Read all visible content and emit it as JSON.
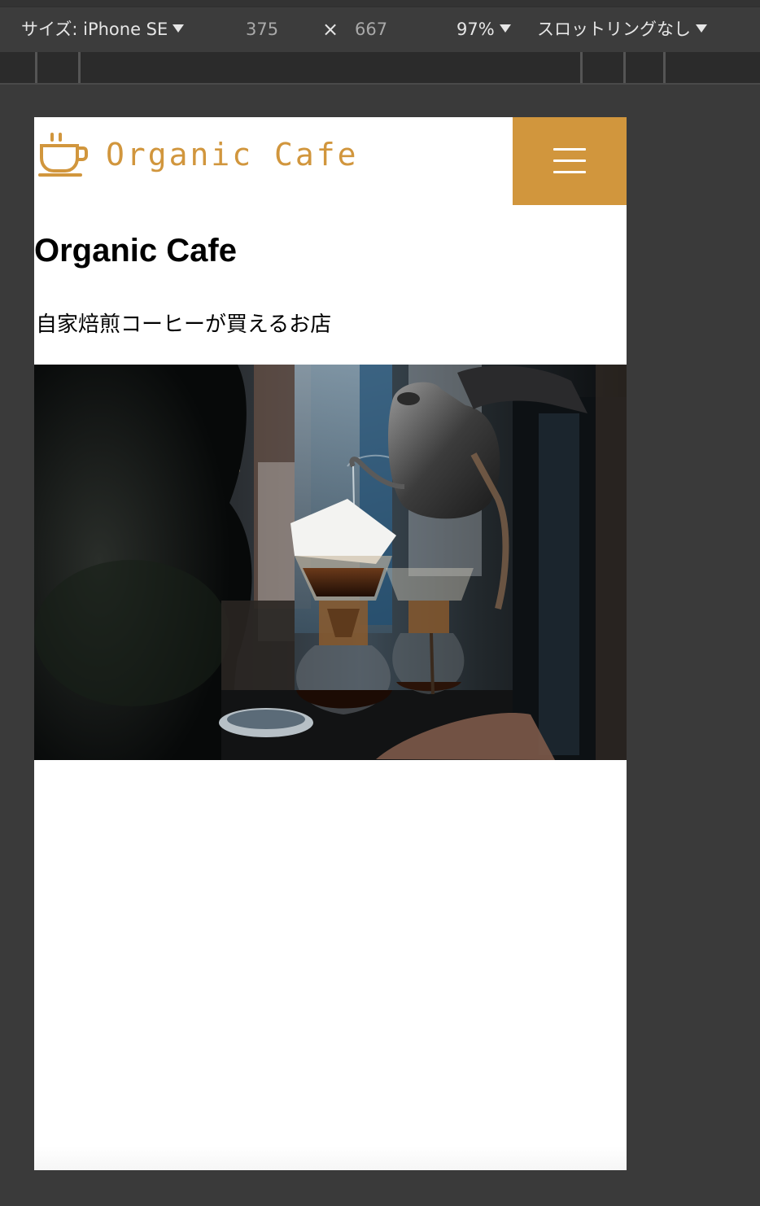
{
  "devtools": {
    "size_label": "サイズ: iPhone SE",
    "width": "375",
    "times": "×",
    "height": "667",
    "zoom": "97%",
    "throttling": "スロットリングなし"
  },
  "site": {
    "logo_text": "Organic Cafe",
    "menu_icon": "hamburger-icon",
    "brand_color": "#d1963d",
    "hero_title": "Organic Cafe",
    "hero_subtitle": "自家焙煎コーヒーが買えるお店"
  }
}
